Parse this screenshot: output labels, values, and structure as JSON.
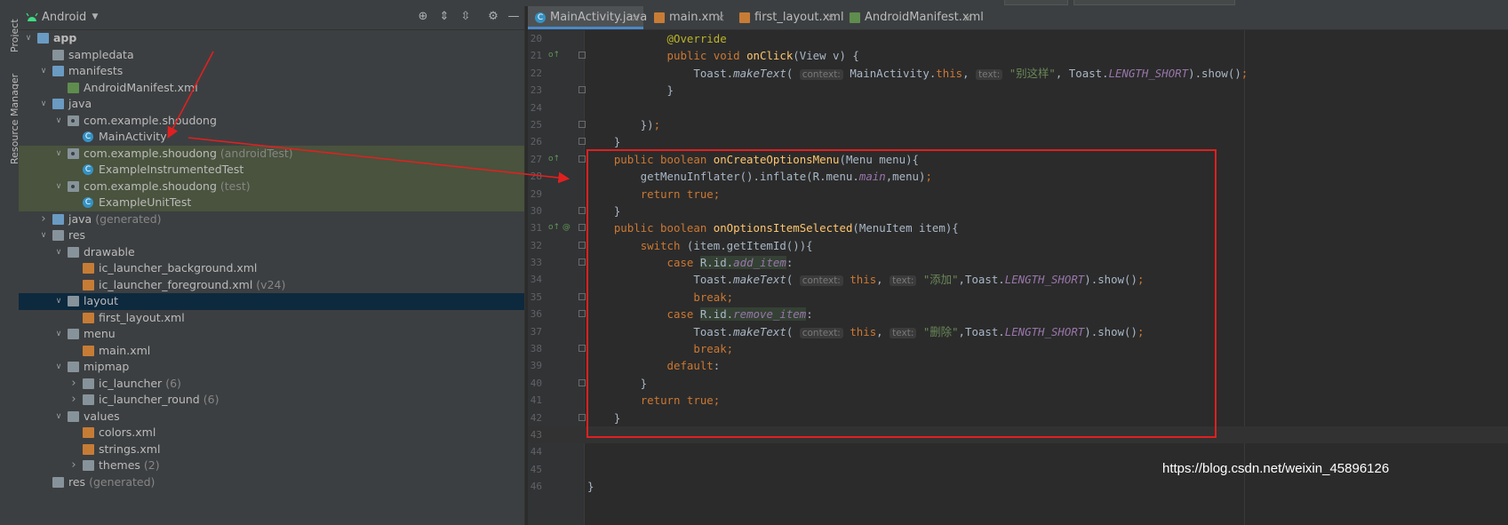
{
  "project_panel": {
    "view_label": "Android",
    "tool_tabs": [
      "Project",
      "Resource Manager"
    ],
    "tree": [
      {
        "label": "app",
        "depth": 0,
        "arrow": "down",
        "icon": "module",
        "bold": true
      },
      {
        "label": "sampledata",
        "depth": 1,
        "arrow": "",
        "icon": "folder"
      },
      {
        "label": "manifests",
        "depth": 1,
        "arrow": "down",
        "icon": "folder-blue"
      },
      {
        "label": "AndroidManifest.xml",
        "depth": 2,
        "arrow": "",
        "icon": "manifest"
      },
      {
        "label": "java",
        "depth": 1,
        "arrow": "down",
        "icon": "folder-blue"
      },
      {
        "label": "com.example.shoudong",
        "depth": 2,
        "arrow": "down",
        "icon": "package"
      },
      {
        "label": "MainActivity",
        "depth": 3,
        "arrow": "",
        "icon": "class"
      },
      {
        "label": "com.example.shoudong",
        "extra": "(androidTest)",
        "depth": 2,
        "arrow": "down",
        "icon": "package",
        "state": "test"
      },
      {
        "label": "ExampleInstrumentedTest",
        "depth": 3,
        "arrow": "",
        "icon": "class",
        "state": "test"
      },
      {
        "label": "com.example.shoudong",
        "extra": "(test)",
        "depth": 2,
        "arrow": "down",
        "icon": "package",
        "state": "test"
      },
      {
        "label": "ExampleUnitTest",
        "depth": 3,
        "arrow": "",
        "icon": "class",
        "state": "test"
      },
      {
        "label": "java",
        "extra": "(generated)",
        "depth": 1,
        "arrow": "right",
        "icon": "folder-blue"
      },
      {
        "label": "res",
        "depth": 1,
        "arrow": "down",
        "icon": "folder"
      },
      {
        "label": "drawable",
        "depth": 2,
        "arrow": "down",
        "icon": "folder"
      },
      {
        "label": "ic_launcher_background.xml",
        "depth": 3,
        "arrow": "",
        "icon": "xml"
      },
      {
        "label": "ic_launcher_foreground.xml",
        "extra": "(v24)",
        "depth": 3,
        "arrow": "",
        "icon": "xml"
      },
      {
        "label": "layout",
        "depth": 2,
        "arrow": "down",
        "icon": "folder",
        "state": "sel"
      },
      {
        "label": "first_layout.xml",
        "depth": 3,
        "arrow": "",
        "icon": "xml"
      },
      {
        "label": "menu",
        "depth": 2,
        "arrow": "down",
        "icon": "folder"
      },
      {
        "label": "main.xml",
        "depth": 3,
        "arrow": "",
        "icon": "xml"
      },
      {
        "label": "mipmap",
        "depth": 2,
        "arrow": "down",
        "icon": "folder"
      },
      {
        "label": "ic_launcher",
        "extra": "(6)",
        "depth": 3,
        "arrow": "right",
        "icon": "folder"
      },
      {
        "label": "ic_launcher_round",
        "extra": "(6)",
        "depth": 3,
        "arrow": "right",
        "icon": "folder"
      },
      {
        "label": "values",
        "depth": 2,
        "arrow": "down",
        "icon": "folder"
      },
      {
        "label": "colors.xml",
        "depth": 3,
        "arrow": "",
        "icon": "xml"
      },
      {
        "label": "strings.xml",
        "depth": 3,
        "arrow": "",
        "icon": "xml"
      },
      {
        "label": "themes",
        "extra": "(2)",
        "depth": 3,
        "arrow": "right",
        "icon": "folder"
      },
      {
        "label": "res",
        "extra": "(generated)",
        "depth": 1,
        "arrow": "",
        "icon": "folder"
      }
    ]
  },
  "editor": {
    "tabs": [
      {
        "label": "MainActivity.java",
        "icon": "class",
        "active": true
      },
      {
        "label": "main.xml",
        "icon": "xml"
      },
      {
        "label": "first_layout.xml",
        "icon": "xml"
      },
      {
        "label": "AndroidManifest.xml",
        "icon": "manifest"
      }
    ],
    "lines": [
      {
        "n": "20",
        "html": "            <span class=\"ann\">@Override</span>"
      },
      {
        "n": "21",
        "mark": "o↑",
        "fold": true,
        "html": "            <span class=\"kw\">public void </span><span class=\"fn\">onClick</span>(View v) {"
      },
      {
        "n": "22",
        "html": "                Toast.<span class=\"it\">makeText</span>( <span class=\"hint\">context:</span> MainActivity.<span class=\"kw\">this</span>, <span class=\"hint\">text:</span> <span class=\"str\">\"别这样\"</span>, Toast.<span class=\"field\">LENGTH_SHORT</span>).show()<span class=\"kw\">;</span>"
      },
      {
        "n": "23",
        "fold": true,
        "html": "            }"
      },
      {
        "n": "24",
        "html": ""
      },
      {
        "n": "25",
        "fold": true,
        "html": "        })<span class=\"kw\">;</span>"
      },
      {
        "n": "26",
        "fold": true,
        "html": "    }"
      },
      {
        "n": "27",
        "mark": "o↑",
        "fold": true,
        "html": "    <span class=\"kw\">public boolean </span><span class=\"fn\">onCreateOptionsMenu</span>(Menu menu){"
      },
      {
        "n": "28",
        "html": "        getMenuInflater().inflate(R.menu.<span class=\"field\">main</span>,menu)<span class=\"kw\">;</span>"
      },
      {
        "n": "29",
        "html": "        <span class=\"kw\">return true;</span>"
      },
      {
        "n": "30",
        "fold": true,
        "html": "    }"
      },
      {
        "n": "31",
        "mark": "o↑ @",
        "fold": true,
        "html": "    <span class=\"kw\">public boolean </span><span class=\"fn\">onOptionsItemSelected</span>(MenuItem item){"
      },
      {
        "n": "32",
        "fold": true,
        "html": "        <span class=\"kw\">switch </span>(item.getItemId()){"
      },
      {
        "n": "33",
        "fold": true,
        "html": "            <span class=\"kw\">case </span><span class=\"hl\">R.id.<span class=\"field\">add_item</span></span>:"
      },
      {
        "n": "34",
        "html": "                Toast.<span class=\"it\">makeText</span>( <span class=\"hint\">context:</span> <span class=\"kw\">this</span>, <span class=\"hint\">text:</span> <span class=\"str\">\"添加\"</span>,Toast.<span class=\"field\">LENGTH_SHORT</span>).show()<span class=\"kw\">;</span>"
      },
      {
        "n": "35",
        "fold": true,
        "html": "                <span class=\"kw\">break;</span>"
      },
      {
        "n": "36",
        "fold": true,
        "html": "            <span class=\"kw\">case </span><span class=\"hl\">R.id.<span class=\"field\">remove_item</span></span>:"
      },
      {
        "n": "37",
        "html": "                Toast.<span class=\"it\">makeText</span>( <span class=\"hint\">context:</span> <span class=\"kw\">this</span>, <span class=\"hint\">text:</span> <span class=\"str\">\"删除\"</span>,Toast.<span class=\"field\">LENGTH_SHORT</span>).show()<span class=\"kw\">;</span>"
      },
      {
        "n": "38",
        "fold": true,
        "html": "                <span class=\"kw\">break;</span>"
      },
      {
        "n": "39",
        "html": "            <span class=\"kw\">default</span>:"
      },
      {
        "n": "40",
        "fold": true,
        "html": "        }"
      },
      {
        "n": "41",
        "html": "        <span class=\"kw\">return true;</span>"
      },
      {
        "n": "42",
        "fold": true,
        "html": "    }"
      },
      {
        "n": "43",
        "caret": true,
        "html": ""
      },
      {
        "n": "44",
        "html": ""
      },
      {
        "n": "45",
        "html": ""
      },
      {
        "n": "46",
        "html": "}"
      }
    ]
  },
  "watermark": "https://blog.csdn.net/weixin_45896126",
  "colors": {
    "annotation_red": "#e02020",
    "keyword": "#cc7832",
    "method": "#ffc66d",
    "string": "#6a8759"
  }
}
